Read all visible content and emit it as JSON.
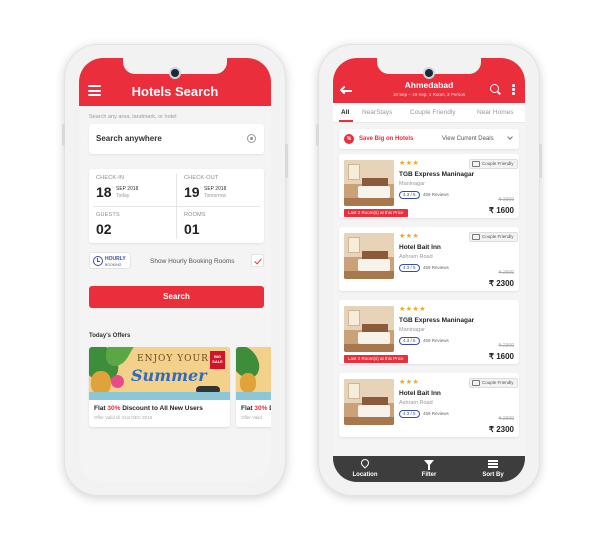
{
  "left": {
    "header": {
      "title": "Hotels Search"
    },
    "search": {
      "hint": "Search any area, landmark, or hotel",
      "value": "Search anywhere"
    },
    "checkin": {
      "label": "CHECK-IN",
      "day": "18",
      "month": "SEP 2018",
      "note": "Today"
    },
    "checkout": {
      "label": "CHECK-OUT",
      "day": "19",
      "month": "SEP 2018",
      "note": "Tomorrow"
    },
    "guests": {
      "label": "GUESTS",
      "value": "02"
    },
    "rooms": {
      "label": "ROOMS",
      "value": "01"
    },
    "hourly": {
      "badge_title": "HOURLY",
      "badge_sub": "BOOKING",
      "label": "Show Hourly Booking Rooms",
      "checked": true
    },
    "search_button": "Search",
    "offers": {
      "title": "Today's Offers",
      "items": [
        {
          "banner_line1": "ENJOY YOUR",
          "banner_line2": "Summer",
          "tag": "BIG SALE",
          "prefix": "Flat ",
          "highlight": "30%",
          "suffix": " Discount to All New Users",
          "validity": "Offer Valid till 21st DEC 2018"
        },
        {
          "prefix": "Flat ",
          "highlight": "30%",
          "suffix": " D",
          "validity": "Offer Valid"
        }
      ]
    }
  },
  "right": {
    "header": {
      "title": "Ahmedabad",
      "subtitle": "18 Sep – 19 Sep, 1 Room, 2 Person"
    },
    "tabs": [
      "All",
      "NearStays",
      "Couple Friendly",
      "Near Homes"
    ],
    "active_tab": "All",
    "promo": {
      "icon": "%",
      "text": "Save Big on Hotels",
      "deals": "View Current Deals"
    },
    "hotels": [
      {
        "stars": "★★★",
        "couple": "Couple Friendly",
        "name": "TGB Express Maninagar",
        "area": "Maninagar",
        "rating": "4.3 / 5",
        "reviews": "459 Reviews",
        "old_price": "₹ 2300",
        "price": "₹ 1600",
        "alert": "Last 2 Room(s) at this Price"
      },
      {
        "stars": "★★★",
        "couple": "Couple Friendly",
        "name": "Hotel Bait Inn",
        "area": "Ashram Road",
        "rating": "4.3 / 5",
        "reviews": "459 Reviews",
        "old_price": "₹ 2900",
        "price": "₹ 2300",
        "alert": ""
      },
      {
        "stars": "★★★★",
        "couple": "",
        "name": "TGB Express Maninagar",
        "area": "Maninagar",
        "rating": "4.3 / 5",
        "reviews": "459 Reviews",
        "old_price": "₹ 2300",
        "price": "₹ 1600",
        "alert": "Last 2 Room(s) at this Price"
      },
      {
        "stars": "★★★",
        "couple": "Couple Friendly",
        "name": "Hotel Bait Inn",
        "area": "Ashram Road",
        "rating": "4.3 / 5",
        "reviews": "459 Reviews",
        "old_price": "₹ 2900",
        "price": "₹ 2300",
        "alert": ""
      }
    ],
    "bottom_nav": [
      {
        "label": "Location",
        "icon": "location-pin-icon"
      },
      {
        "label": "Filter",
        "icon": "filter-icon"
      },
      {
        "label": "Sort By",
        "icon": "sort-icon"
      }
    ]
  },
  "colors": {
    "accent": "#ea2e3c",
    "nav_bg": "#3d3d3d",
    "star": "#f2a81d",
    "rating_blue": "#3a4fa0"
  }
}
